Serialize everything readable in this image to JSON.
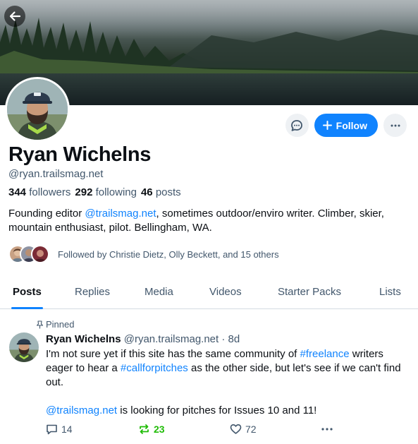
{
  "profile": {
    "display_name": "Ryan Wichelns",
    "handle": "@ryan.trailsmag.net",
    "followers_count": "344",
    "followers_label": "followers",
    "following_count": "292",
    "following_label": "following",
    "posts_count": "46",
    "posts_label": "posts",
    "bio_pre": "Founding editor ",
    "bio_link": "@trailsmag.net",
    "bio_post": ", sometimes outdoor/enviro writer. Climber, skier, mountain enthusiast, pilot. Bellingham, WA.",
    "followed_by": "Followed by Christie Dietz, Olly Beckett, and 15 others"
  },
  "actions": {
    "follow_label": "Follow"
  },
  "tabs": [
    {
      "label": "Posts"
    },
    {
      "label": "Replies"
    },
    {
      "label": "Media"
    },
    {
      "label": "Videos"
    },
    {
      "label": "Starter Packs"
    },
    {
      "label": "Lists"
    }
  ],
  "post": {
    "pinned_label": "Pinned",
    "author": "Ryan Wichelns",
    "author_handle": "@ryan.trailsmag.net",
    "time": "· 8d",
    "p1_a": "I'm not sure yet if this site has the same community of ",
    "p1_tag1": "#freelance",
    "p1_b": " writers eager to hear a ",
    "p1_tag2": "#callforpitches",
    "p1_c": " as the other side, but let's see if we can't find out.",
    "p2_mention": "@trailsmag.net",
    "p2_rest": " is looking for pitches for Issues 10 and 11!",
    "replies": "14",
    "reposts": "23",
    "likes": "72"
  },
  "colors": {
    "accent": "#1083fe",
    "repost_active": "#20bc07",
    "muted_text": "#42576c"
  }
}
